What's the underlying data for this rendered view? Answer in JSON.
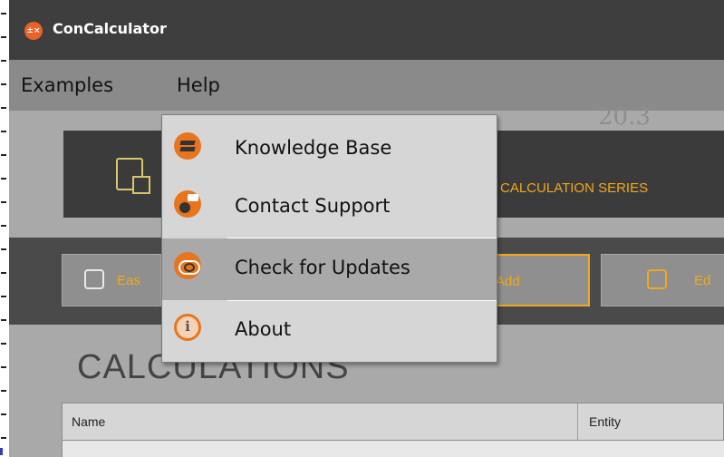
{
  "window": {
    "title": "ConCalculator",
    "icon": "app-calculator-icon",
    "accent_color": "#e8622a"
  },
  "menubar": {
    "items": [
      {
        "label": "Examples"
      },
      {
        "label": "Help"
      }
    ]
  },
  "help_menu": {
    "items": [
      {
        "label": "Knowledge Base",
        "icon": "books-icon"
      },
      {
        "label": "Contact Support",
        "icon": "support-chat-icon"
      },
      {
        "label": "Check for Updates",
        "icon": "update-cloud-icon",
        "highlighted": true
      },
      {
        "label": "About",
        "icon": "info-icon"
      }
    ],
    "highlight_color": "#a9a9a9"
  },
  "background": {
    "tile_label": "CALCULATION SERIES",
    "faint_number": "20.3",
    "toolbar": {
      "easy_label": "Eas",
      "add_label": "Add",
      "edit_label": "Ed"
    },
    "section_title": "CALCULATIONS",
    "grid": {
      "columns": [
        "Name",
        "Entity"
      ]
    },
    "accent_color": "#f2a81d"
  }
}
